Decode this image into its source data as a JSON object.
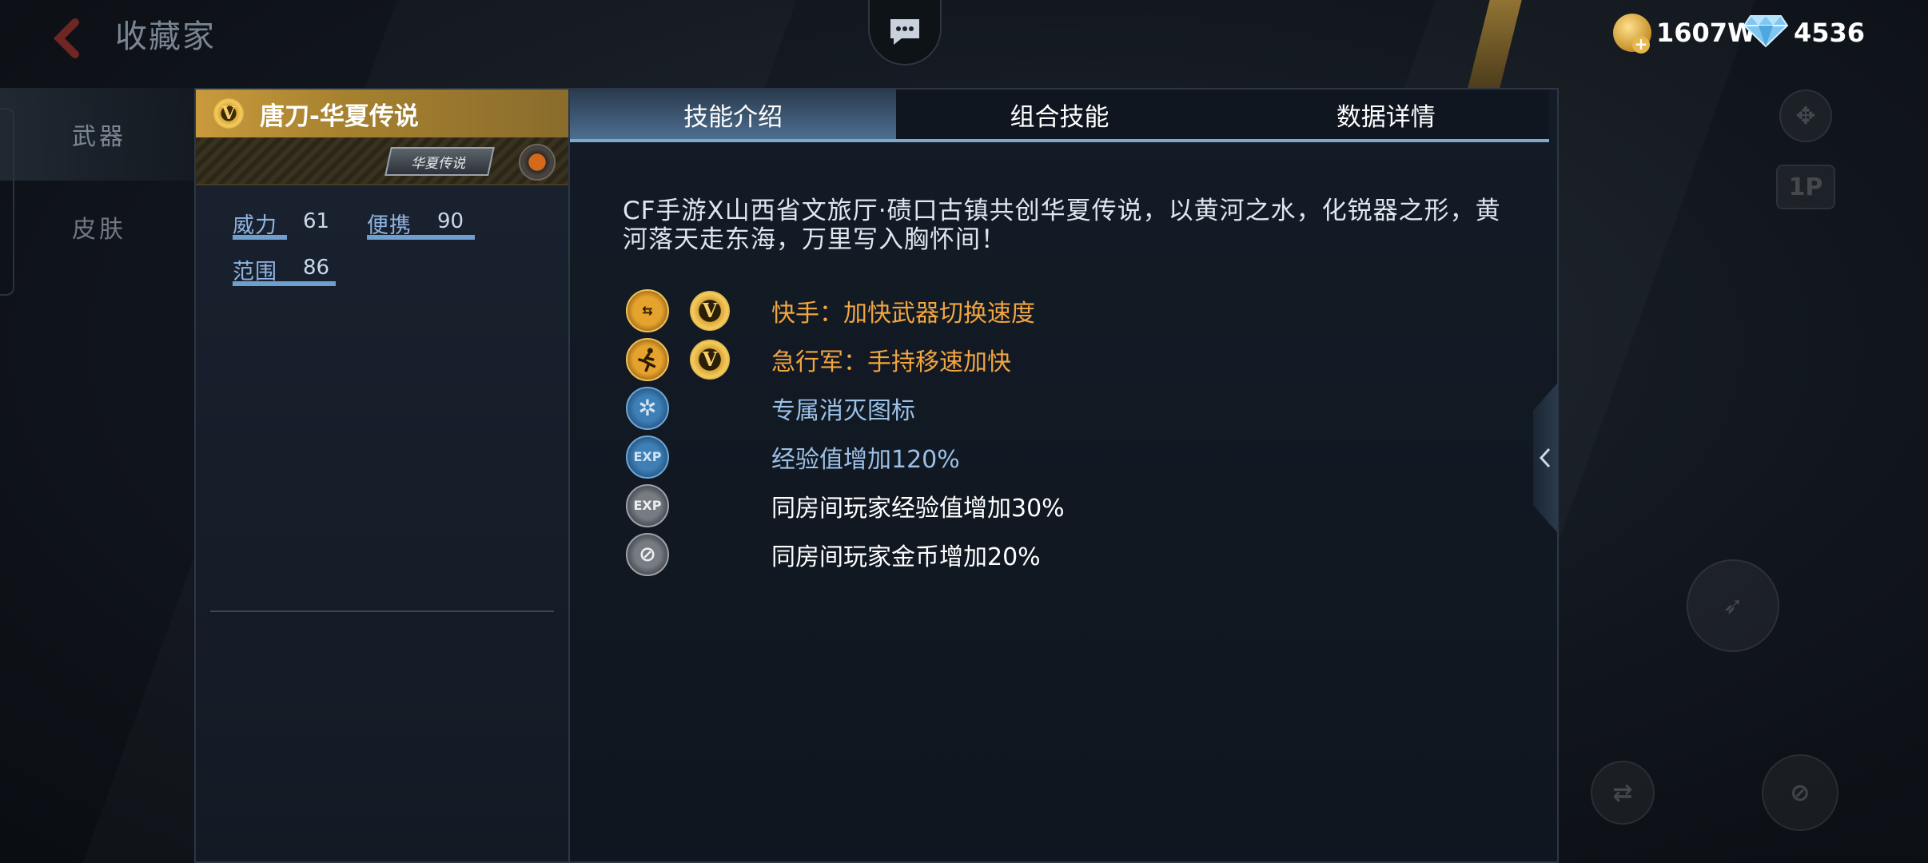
{
  "header": {
    "back_icon": "chevron-left-icon",
    "title": "收藏家",
    "chat_icon": "chat-bubble-icon"
  },
  "currency": {
    "coin_value": "1607W",
    "gem_value": "4536"
  },
  "side_nav": {
    "items": [
      {
        "label": "武器"
      },
      {
        "label": "皮肤"
      }
    ]
  },
  "weapon": {
    "badge": "V",
    "name": "唐刀-华夏传说",
    "tag": "华夏传说",
    "stats": [
      {
        "label": "威力",
        "value": "61",
        "fraction": 0.61
      },
      {
        "label": "便携",
        "value": "90",
        "fraction": 0.9
      },
      {
        "label": "范围",
        "value": "86",
        "fraction": 0.86
      }
    ]
  },
  "tabs": [
    {
      "label": "技能介绍",
      "active": true
    },
    {
      "label": "组合技能",
      "active": false
    },
    {
      "label": "数据详情",
      "active": false
    }
  ],
  "description": "CF手游X山西省文旅厅·碛口古镇共创华夏传说，以黄河之水，化锐器之形，黄河落天走东海，万里写入胸怀间！",
  "skills": [
    {
      "icon": "quick-switch-icon",
      "icon_text": "⇆",
      "v_badge": "V",
      "text": "快手：加快武器切换速度",
      "color": "gold"
    },
    {
      "icon": "running-man-icon",
      "icon_text": "🏃",
      "v_badge": "V",
      "text": "急行军：手持移速加快",
      "color": "gold"
    },
    {
      "icon": "kill-mark-icon",
      "icon_text": "✲",
      "v_badge": "",
      "text": "专属消灭图标",
      "color": "blue"
    },
    {
      "icon": "exp-plus-icon",
      "icon_text": "EXP",
      "v_badge": "",
      "text": "经验值增加120%",
      "color": "blue"
    },
    {
      "icon": "room-exp-icon",
      "icon_text": "EXP",
      "v_badge": "",
      "text": "同房间玩家经验值增加30%",
      "color": "white"
    },
    {
      "icon": "room-coin-icon",
      "icon_text": "⊘",
      "v_badge": "",
      "text": "同房间玩家金币增加20%",
      "color": "white"
    }
  ],
  "right_controls": {
    "player_label": "1P"
  }
}
